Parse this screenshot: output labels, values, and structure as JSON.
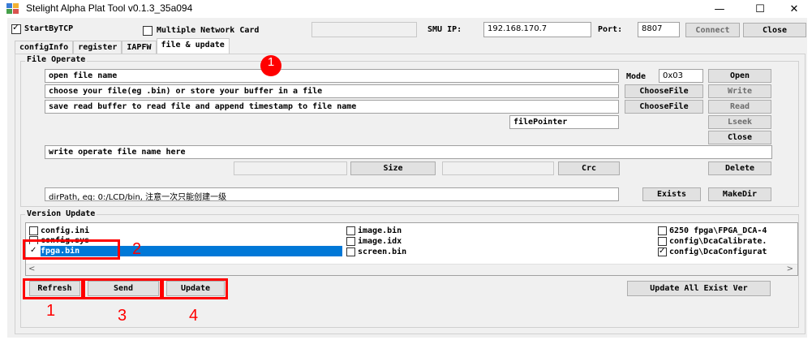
{
  "window": {
    "title": "Stelight Alpha Plat Tool v0.1.3_35a094",
    "minimize": "—",
    "maximize": "☐",
    "close": "✕"
  },
  "topbar": {
    "start_by_tcp": "StartByTCP",
    "multiple_network_card": "Multiple Network Card",
    "smu_ip_label": "SMU IP:",
    "smu_ip_value": "192.168.170.7",
    "port_label": "Port:",
    "port_value": "8807",
    "connect": "Connect",
    "close": "Close"
  },
  "tabs": [
    "configInfo",
    "register",
    "IAPFW",
    "file & update"
  ],
  "file_operate": {
    "title": "File Operate",
    "file_name": "open file name",
    "mode_label": "Mode",
    "mode_value": "0x03",
    "open": "Open",
    "choose_text": "choose your file(eg .bin) or store your buffer in a file",
    "choose_file_1": "ChooseFile",
    "write": "Write",
    "save_text": "save read buffer to read file and append timestamp to file name",
    "choose_file_2": "ChooseFile",
    "read": "Read",
    "file_pointer": "filePointer",
    "lseek": "Lseek",
    "close": "Close",
    "write_name": "write operate file name here",
    "size": "Size",
    "crc": "Crc",
    "delete": "Delete",
    "dir_path": "dirPath, eg: 0:/LCD/bin, 注意一次只能创建一级",
    "exists": "Exists",
    "make_dir": "MakeDir"
  },
  "version_update": {
    "title": "Version Update",
    "col1": [
      {
        "label": "config.ini",
        "checked": false
      },
      {
        "label": "config.sys",
        "checked": false
      },
      {
        "label": "fpga.bin",
        "checked": true
      }
    ],
    "col2": [
      {
        "label": "image.bin",
        "checked": false
      },
      {
        "label": "image.idx",
        "checked": false
      },
      {
        "label": "screen.bin",
        "checked": false
      }
    ],
    "col3": [
      {
        "label": "6250 fpga\\FPGA_DCA-4",
        "checked": false
      },
      {
        "label": "config\\DcaCalibrate.",
        "checked": false
      },
      {
        "label": "config\\DcaConfigurat",
        "checked": true
      }
    ],
    "scroll_left": "<",
    "scroll_right": ">",
    "refresh": "Refresh",
    "send": "Send",
    "update": "Update",
    "update_all": "Update All Exist Ver"
  },
  "annotations": {
    "n1_top": "1",
    "n2": "2",
    "n1_bottom": "1",
    "n3": "3",
    "n4": "4"
  },
  "colors": {
    "selection": "#0078d7",
    "annotation": "#ff0000"
  }
}
